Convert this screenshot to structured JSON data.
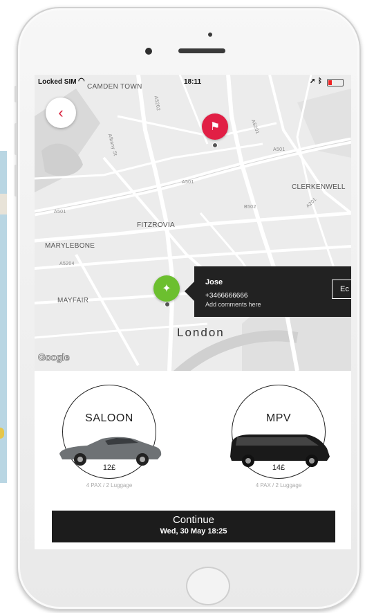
{
  "status_bar": {
    "carrier": "Locked SIM",
    "time": "18:11"
  },
  "map": {
    "place_labels": [
      "CAMDEN TOWN",
      "CLERKENWELL",
      "FITZROVIA",
      "MARYLEBONE",
      "MAYFAIR",
      "London"
    ],
    "road_labels": [
      "A501",
      "A501",
      "A501",
      "A5202",
      "A5201",
      "A5204",
      "B502",
      "A201",
      "Albany St"
    ],
    "attribution": "Google"
  },
  "driver_card": {
    "name": "Jose",
    "phone": "+3466666666",
    "comments": "Add comments here",
    "action": "Ec"
  },
  "vehicles": [
    {
      "name": "SALOON",
      "price": "12£",
      "capacity": "4 PAX / 2 Luggage",
      "car_color": "#6e7275"
    },
    {
      "name": "MPV",
      "price": "14£",
      "capacity": "4 PAX / 2 Luggage",
      "car_color": "#1a1a1a"
    }
  ],
  "continue_button": {
    "label": "Continue",
    "datetime": "Wed, 30 May 18:25"
  },
  "colors": {
    "accent": "#e11f45",
    "origin_pin": "#6cbf2f",
    "dark": "#1c1c1c"
  },
  "icons": {
    "back": "chevron-left-icon",
    "destination": "flag-icon",
    "origin": "person-pin-icon"
  }
}
